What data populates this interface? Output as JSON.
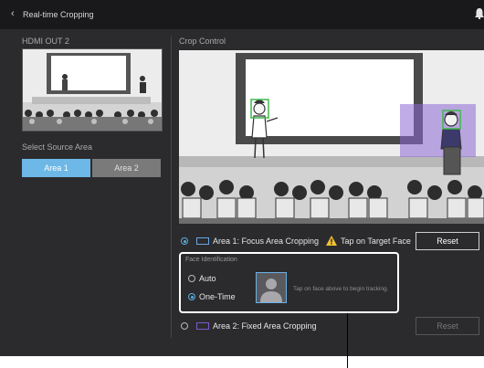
{
  "titlebar": {
    "back_glyph": "‹",
    "title": "Real-time Cropping",
    "bell_icon": "bell-icon"
  },
  "left": {
    "output_label": "HDMI OUT  2",
    "select_label": "Select Source Area",
    "area1_label": "Area 1",
    "area2_label": "Area 2"
  },
  "crop": {
    "label": "Crop Control",
    "area1_text": "Area 1: Focus Area Cropping",
    "warning_text": "Tap on Target Face",
    "area2_text": "Area 2: Fixed Area Cropping",
    "reset_label": "Reset",
    "reset2_label": "Reset"
  },
  "face": {
    "label": "Face Identification",
    "auto_label": "Auto",
    "onetime_label": "One-Time",
    "hint": "Tap on face above to begin tracking."
  },
  "colors": {
    "accent": "#6db8e6",
    "crop_overlay": "#8d6ad6",
    "face_box": "#3fb94a",
    "warning": "#f2c230"
  }
}
